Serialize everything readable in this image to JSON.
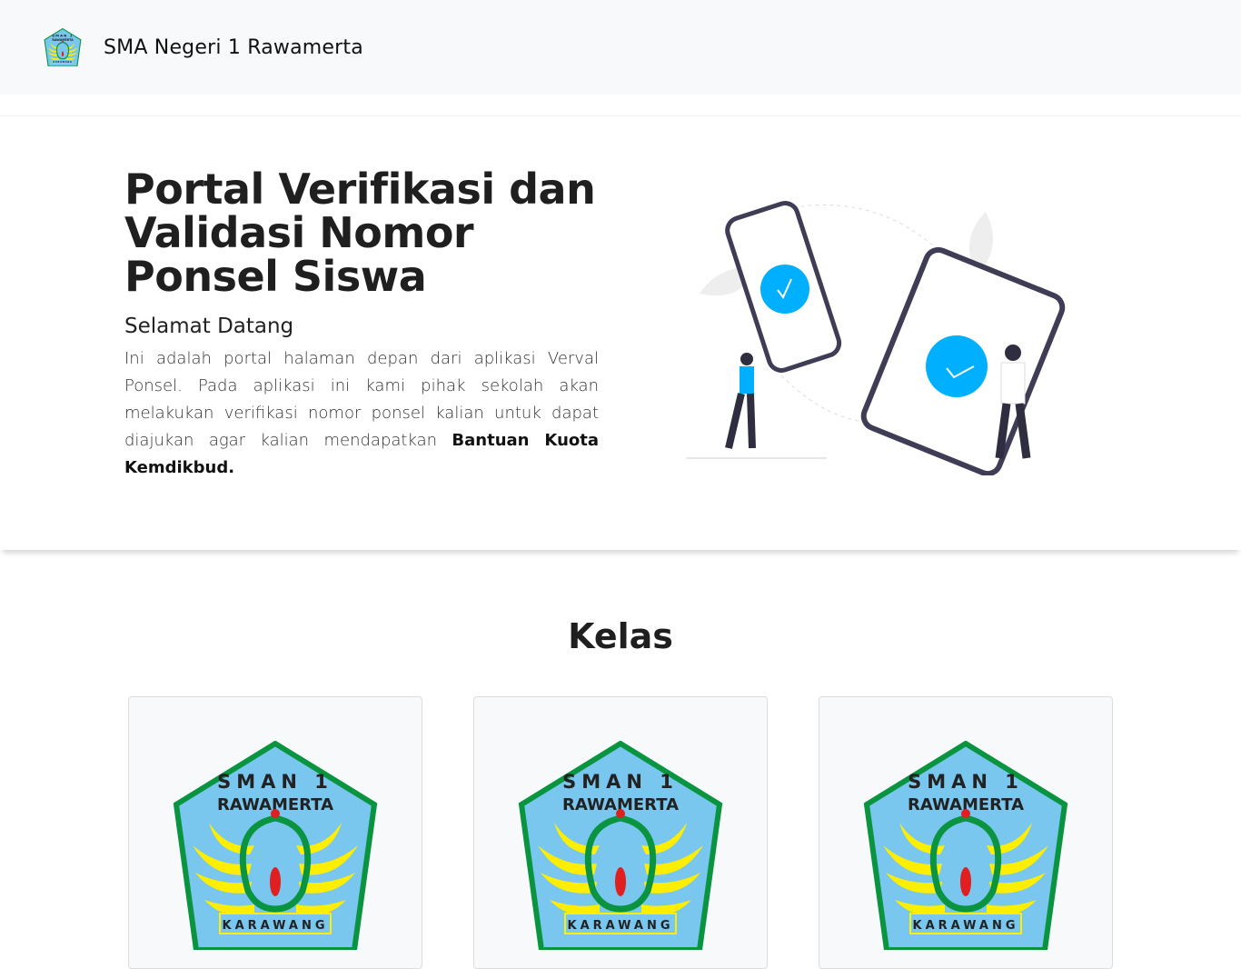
{
  "navbar": {
    "brand": "SMA Negeri 1 Rawamerta",
    "logo_text": "SMAN 1 RAWAMERTA KARAWANG"
  },
  "hero": {
    "title": "Portal Verifikasi dan Validasi Nomor Ponsel Siswa",
    "subtitle": "Selamat Datang",
    "description": "Ini adalah portal halaman depan dari aplikasi Verval Ponsel. Pada aplikasi ini kami pihak sekolah akan melakukan verifikasi nomor ponsel kalian untuk dapat diajukan agar kalian mendapatkan",
    "description_bold": "Bantuan Kuota Kemdikbud."
  },
  "section": {
    "title": "Kelas"
  },
  "cards": [
    {
      "logo_text": "SMAN 1 RAWAMERTA KARAWANG"
    },
    {
      "logo_text": "SMAN 1 RAWAMERTA KARAWANG"
    },
    {
      "logo_text": "SMAN 1 RAWAMERTA KARAWANG"
    }
  ],
  "colors": {
    "accent": "#00b0ff",
    "navbar_bg": "#f8f9fa"
  }
}
